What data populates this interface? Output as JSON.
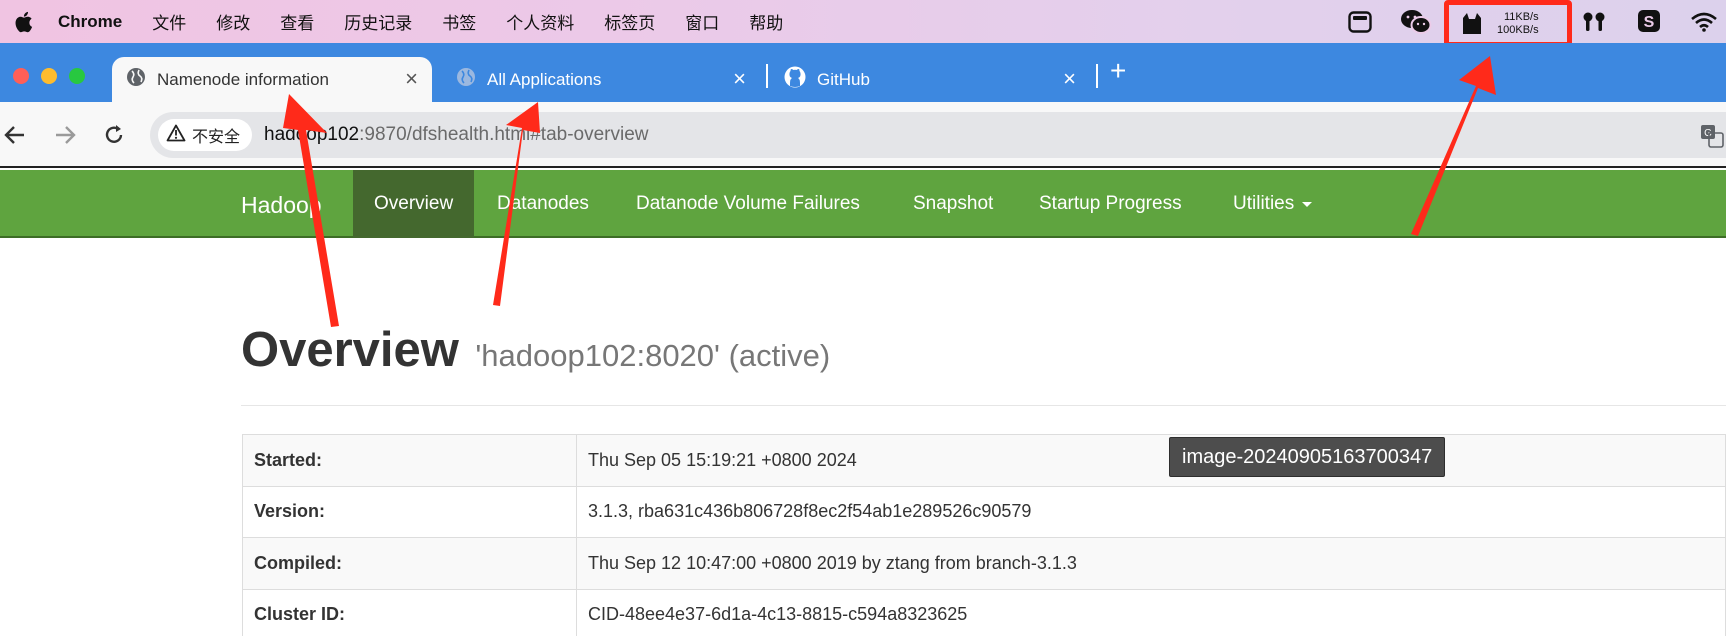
{
  "menubar": {
    "app_name": "Chrome",
    "items": [
      "文件",
      "修改",
      "查看",
      "历史记录",
      "书签",
      "个人资料",
      "标签页",
      "窗口",
      "帮助"
    ],
    "net_speed": {
      "up": "11KB/s",
      "down": "100KB/s"
    },
    "status_icons": [
      "screen-mirror-icon",
      "wechat-icon",
      "cat-icon",
      "airpods-icon",
      "sogou-input-icon",
      "wifi-icon"
    ]
  },
  "tabs": [
    {
      "title": "Namenode information",
      "icon": "globe-icon",
      "active": true
    },
    {
      "title": "All Applications",
      "icon": "globe-icon",
      "active": false
    },
    {
      "title": "GitHub",
      "icon": "github-icon",
      "active": false
    }
  ],
  "toolbar": {
    "security_label": "不安全",
    "url_host": "hadoop102",
    "url_rest": ":9870/dfshealth.html#tab-overview"
  },
  "hadoop_nav": {
    "brand": "Hadoop",
    "items": [
      "Overview",
      "Datanodes",
      "Datanode Volume Failures",
      "Snapshot",
      "Startup Progress",
      "Utilities"
    ],
    "active_item": "Overview"
  },
  "page": {
    "title": "Overview",
    "subtitle": "'hadoop102:8020' (active)",
    "rows": [
      {
        "key": "Started:",
        "value": "Thu Sep 05 15:19:21 +0800 2024"
      },
      {
        "key": "Version:",
        "value": "3.1.3, rba631c436b806728f8ec2f54ab1e289526c90579"
      },
      {
        "key": "Compiled:",
        "value": "Thu Sep 12 10:47:00 +0800 2019 by ztang from branch-3.1.3"
      },
      {
        "key": "Cluster ID:",
        "value": "CID-48ee4e37-6d1a-4c13-8815-c594a8323625"
      }
    ]
  },
  "tooltip": "image-20240905163700347",
  "colors": {
    "tab_strip": "#3d88e0",
    "hadoop_green": "#5fa43f",
    "hadoop_active": "#44682e",
    "annotation_red": "#ff2a1a"
  }
}
